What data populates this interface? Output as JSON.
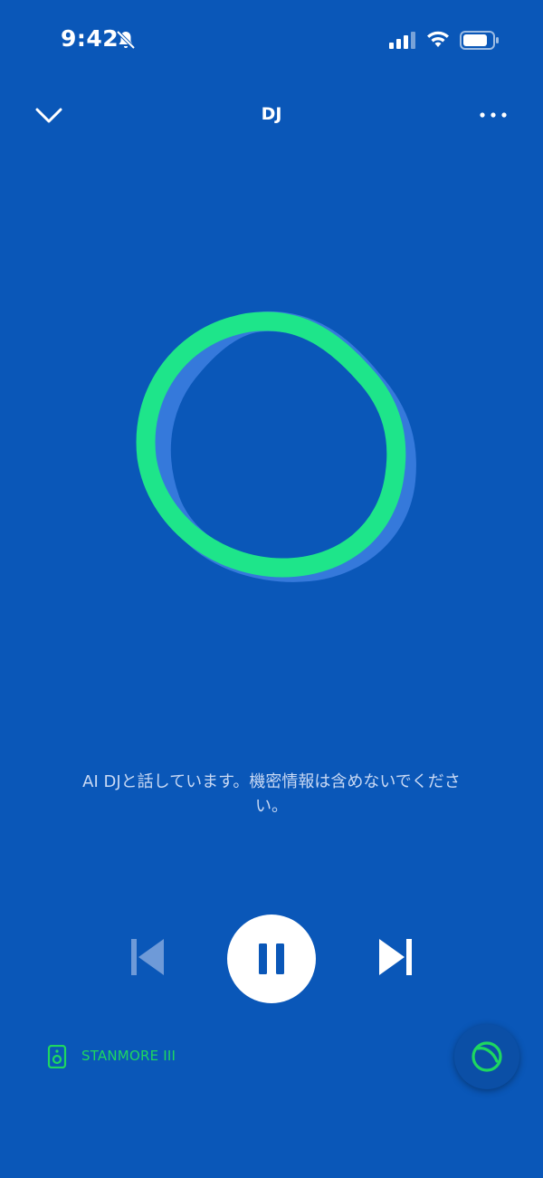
{
  "status_bar": {
    "time": "9:42",
    "icons": [
      "bell-slash-icon",
      "signal-icon",
      "wifi-icon",
      "battery-icon"
    ]
  },
  "header": {
    "title": "DJ",
    "collapse_icon": "chevron-down-icon",
    "more_icon": "more-icon"
  },
  "main": {
    "message": "AI DJと話しています。機密情報は含めないでください。"
  },
  "controls": {
    "previous_icon": "skip-previous-icon",
    "pause_icon": "pause-icon",
    "next_icon": "skip-next-icon"
  },
  "device": {
    "icon": "speaker-icon",
    "name": "STANMORE III"
  },
  "dj_button": {
    "icon": "dj-icon"
  },
  "colors": {
    "background": "#0a57b8",
    "accent_green": "#1ed760",
    "text_muted": "#c9d9f4"
  }
}
